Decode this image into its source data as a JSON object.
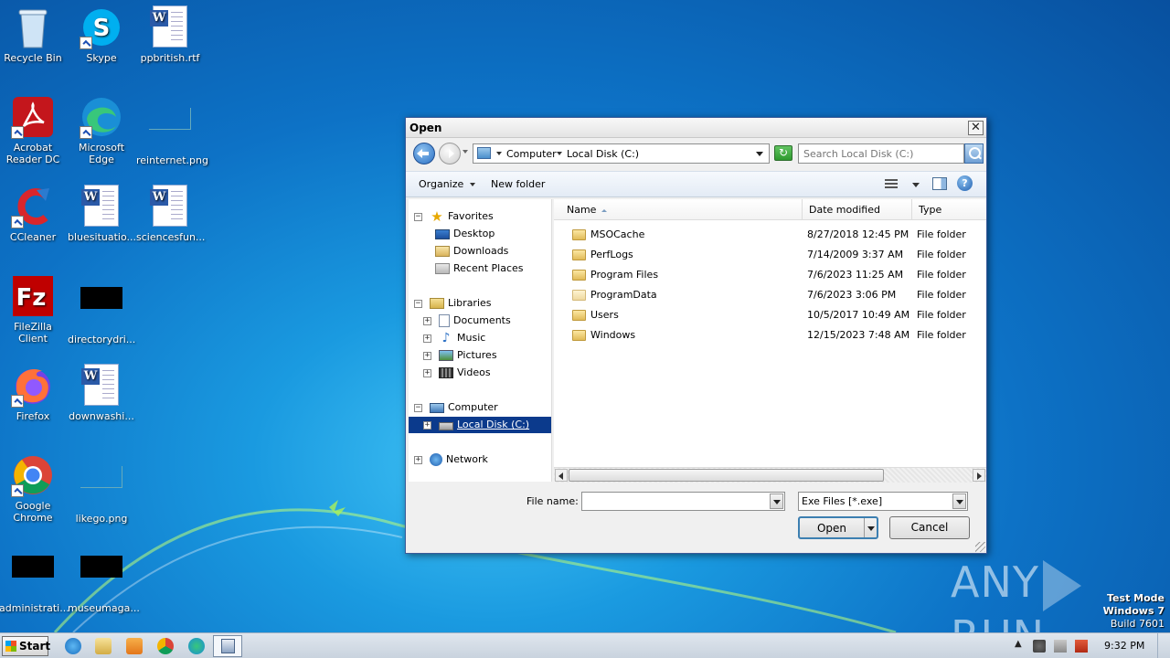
{
  "desktop": {
    "icons": [
      {
        "label": "Recycle Bin",
        "icon": "recycle-bin-icon"
      },
      {
        "label": "Skype",
        "icon": "skype-icon"
      },
      {
        "label": "ppbritish.rtf",
        "icon": "word-document-icon"
      },
      {
        "label": "Acrobat Reader DC",
        "icon": "acrobat-icon"
      },
      {
        "label": "Microsoft Edge",
        "icon": "edge-icon"
      },
      {
        "label": "reinternet.png",
        "icon": "image-file-icon"
      },
      {
        "label": "CCleaner",
        "icon": "ccleaner-icon"
      },
      {
        "label": "bluesituatio...",
        "icon": "word-document-icon"
      },
      {
        "label": "sciencesfun...",
        "icon": "word-document-icon"
      },
      {
        "label": "FileZilla Client",
        "icon": "filezilla-icon"
      },
      {
        "label": "directorydri...",
        "icon": "black-file-icon"
      },
      {
        "label": "Firefox",
        "icon": "firefox-icon"
      },
      {
        "label": "downwashi...",
        "icon": "word-document-icon"
      },
      {
        "label": "Google Chrome",
        "icon": "chrome-icon"
      },
      {
        "label": "likego.png",
        "icon": "image-file-icon"
      },
      {
        "label": "administrati...",
        "icon": "black-file-icon"
      },
      {
        "label": "museumaga...",
        "icon": "black-file-icon"
      }
    ]
  },
  "dialog": {
    "title": "Open",
    "close_glyph": "✕",
    "address": {
      "crumbs": [
        "Computer",
        "Local Disk (C:)"
      ]
    },
    "refresh_glyph": "↻",
    "search_placeholder": "Search Local Disk (C:)",
    "toolbar": {
      "organize": "Organize",
      "new_folder": "New folder",
      "help_glyph": "?"
    },
    "nav_tree": {
      "favorites": "Favorites",
      "desktop": "Desktop",
      "downloads": "Downloads",
      "recent_places": "Recent Places",
      "libraries": "Libraries",
      "documents": "Documents",
      "music": "Music",
      "pictures": "Pictures",
      "videos": "Videos",
      "computer": "Computer",
      "local_disk": "Local Disk (C:)",
      "network": "Network",
      "star_glyph": "★",
      "note_glyph": "♪",
      "minus": "−",
      "plus": "+"
    },
    "columns": {
      "name": "Name",
      "date_modified": "Date modified",
      "type": "Type"
    },
    "files": [
      {
        "name": "MSOCache",
        "date": "8/27/2018 12:45 PM",
        "type": "File folder"
      },
      {
        "name": "PerfLogs",
        "date": "7/14/2009 3:37 AM",
        "type": "File folder"
      },
      {
        "name": "Program Files",
        "date": "7/6/2023 11:25 AM",
        "type": "File folder"
      },
      {
        "name": "ProgramData",
        "date": "7/6/2023 3:06 PM",
        "type": "File folder"
      },
      {
        "name": "Users",
        "date": "10/5/2017 10:49 AM",
        "type": "File folder"
      },
      {
        "name": "Windows",
        "date": "12/15/2023 7:48 AM",
        "type": "File folder"
      }
    ],
    "file_name_label": "File name:",
    "file_name_value": "",
    "filter_value": "Exe Files [*.exe]",
    "open_label": "Open",
    "cancel_label": "Cancel"
  },
  "watermark": {
    "left": "ANY",
    "right": "RUN"
  },
  "os_info": {
    "line1": "Test Mode",
    "line2": "Windows 7",
    "line3": "Build 7601"
  },
  "taskbar": {
    "start_label": "Start",
    "clock": "9:32 PM",
    "tray_arrow": "▲"
  }
}
